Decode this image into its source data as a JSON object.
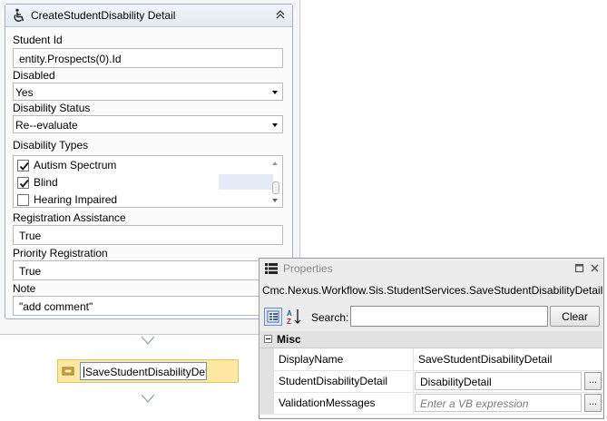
{
  "activity": {
    "title": "CreateStudentDisability Detail",
    "icon": "wheelchair-icon",
    "fields": {
      "student_id": {
        "label": "Student Id",
        "value": "entity.Prospects(0).Id"
      },
      "disabled": {
        "label": "Disabled",
        "value": "Yes"
      },
      "disability_status": {
        "label": "Disability Status",
        "value": "Re--evaluate"
      },
      "disability_types": {
        "label": "Disability Types",
        "items": [
          {
            "label": "Autism Spectrum",
            "checked": true
          },
          {
            "label": "Blind",
            "checked": true
          },
          {
            "label": "Hearing Impaired",
            "checked": false
          }
        ]
      },
      "registration_assistance": {
        "label": "Registration Assistance",
        "value": "True"
      },
      "priority_registration": {
        "label": "Priority Registration",
        "value": "True"
      },
      "note": {
        "label": "Note",
        "value": "\"add comment\""
      }
    }
  },
  "sequence_activity": {
    "name": "SaveStudentDisabilityDet",
    "icon": "activity-icon"
  },
  "properties": {
    "title": "Properties",
    "type_name": "Cmc.Nexus.Workflow.Sis.StudentServices.SaveStudentDisabilityDetail",
    "search_label": "Search:",
    "search_value": "",
    "clear_label": "Clear",
    "category": "Misc",
    "rows": [
      {
        "name": "DisplayName",
        "value": "SaveStudentDisabilityDetail"
      },
      {
        "name": "StudentDisabilityDetail",
        "value": "DisabilityDetail",
        "ellipsis": "..."
      },
      {
        "name": "ValidationMessages",
        "placeholder": "Enter a VB expression",
        "ellipsis": "..."
      }
    ]
  },
  "colors": {
    "selection": "#e6eaf6",
    "activity_fill": "#fde9a4",
    "accent_border": "#6b8fc4"
  }
}
